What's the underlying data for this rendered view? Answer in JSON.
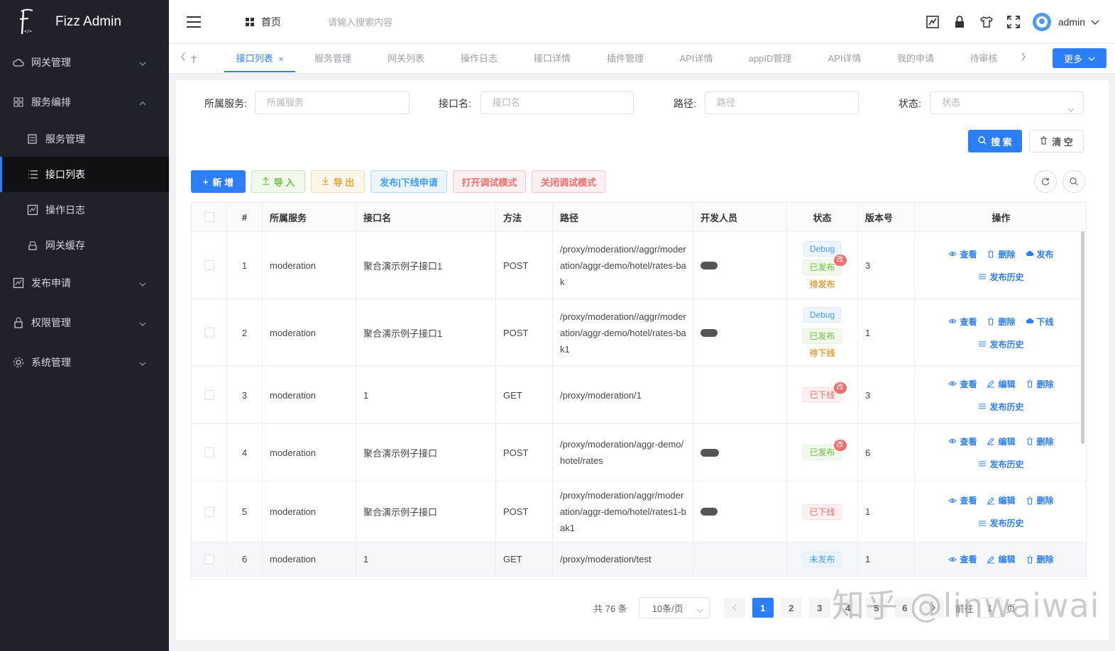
{
  "app": {
    "title": "Fizz Admin"
  },
  "sidebar": {
    "items": [
      {
        "label": "网关管理"
      },
      {
        "label": "服务编排"
      },
      {
        "label": "发布申请"
      },
      {
        "label": "权限管理"
      },
      {
        "label": "系统管理"
      }
    ],
    "sub": [
      {
        "label": "服务管理"
      },
      {
        "label": "接口列表"
      },
      {
        "label": "操作日志"
      },
      {
        "label": "网关缓存"
      }
    ]
  },
  "header": {
    "home": "首页",
    "search_placeholder": "请输入搜索内容",
    "user": "admin"
  },
  "tabs": {
    "items": [
      "接口列表",
      "服务管理",
      "网关列表",
      "操作日志",
      "接口详情",
      "插件管理",
      "API详情",
      "appID管理",
      "API详情",
      "我的申请",
      "待审核"
    ],
    "close": "×",
    "more": "更多"
  },
  "filters": {
    "service_label": "所属服务:",
    "service_ph": "所属服务",
    "name_label": "接口名:",
    "name_ph": "接口名",
    "path_label": "路径:",
    "path_ph": "路径",
    "status_label": "状态:",
    "status_ph": "状态",
    "search_btn": "搜 索",
    "clear_btn": "清 空"
  },
  "toolbar": {
    "add": "新 增",
    "import": "导 入",
    "export": "导 出",
    "publish": "发布|下线申请",
    "open_debug": "打开调试模式",
    "close_debug": "关闭调试模式"
  },
  "table": {
    "headers": [
      "#",
      "所属服务",
      "接口名",
      "方法",
      "路径",
      "开发人员",
      "状态",
      "版本号",
      "操作"
    ],
    "rows": [
      {
        "idx": "1",
        "service": "moderation",
        "name": "聚合演示例子接口1",
        "method": "POST",
        "path": "/proxy/moderation//aggr/moderation/aggr-demo/hotel/rates-bak",
        "version": "3"
      },
      {
        "idx": "2",
        "service": "moderation",
        "name": "聚合演示例子接口1",
        "method": "POST",
        "path": "/proxy/moderation//aggr/moderation/aggr-demo/hotel/rates-bak1",
        "version": "1"
      },
      {
        "idx": "3",
        "service": "moderation",
        "name": "1",
        "method": "GET",
        "path": "/proxy/moderation/1",
        "version": "3"
      },
      {
        "idx": "4",
        "service": "moderation",
        "name": "聚合演示例子接口",
        "method": "POST",
        "path": "/proxy/moderation/aggr-demo/hotel/rates",
        "version": "6"
      },
      {
        "idx": "5",
        "service": "moderation",
        "name": "聚合演示例子接口",
        "method": "POST",
        "path": "/proxy/moderation/aggr/moderation/aggr-demo/hotel/rates1-bak1",
        "version": "1"
      },
      {
        "idx": "6",
        "service": "moderation",
        "name": "1",
        "method": "GET",
        "path": "/proxy/moderation/test",
        "version": "1"
      }
    ],
    "status": {
      "debug": "Debug",
      "published": "已发布",
      "offline": "已下线",
      "unpublished": "未发布",
      "pending_pub": "待发布",
      "pending_off": "待下线",
      "changed": "改"
    },
    "ops": {
      "view": "查看",
      "delete": "删除",
      "publish": "发布",
      "offline": "下线",
      "edit": "编辑",
      "history": "发布历史"
    }
  },
  "pager": {
    "total": "共 76 条",
    "size": "10条/页",
    "pages": [
      "1",
      "2",
      "3",
      "4",
      "5",
      "6"
    ],
    "current": "1",
    "goto_prefix": "前往",
    "goto_value": "1",
    "goto_suffix": "页"
  },
  "watermark": "知乎 @linwaiwai"
}
